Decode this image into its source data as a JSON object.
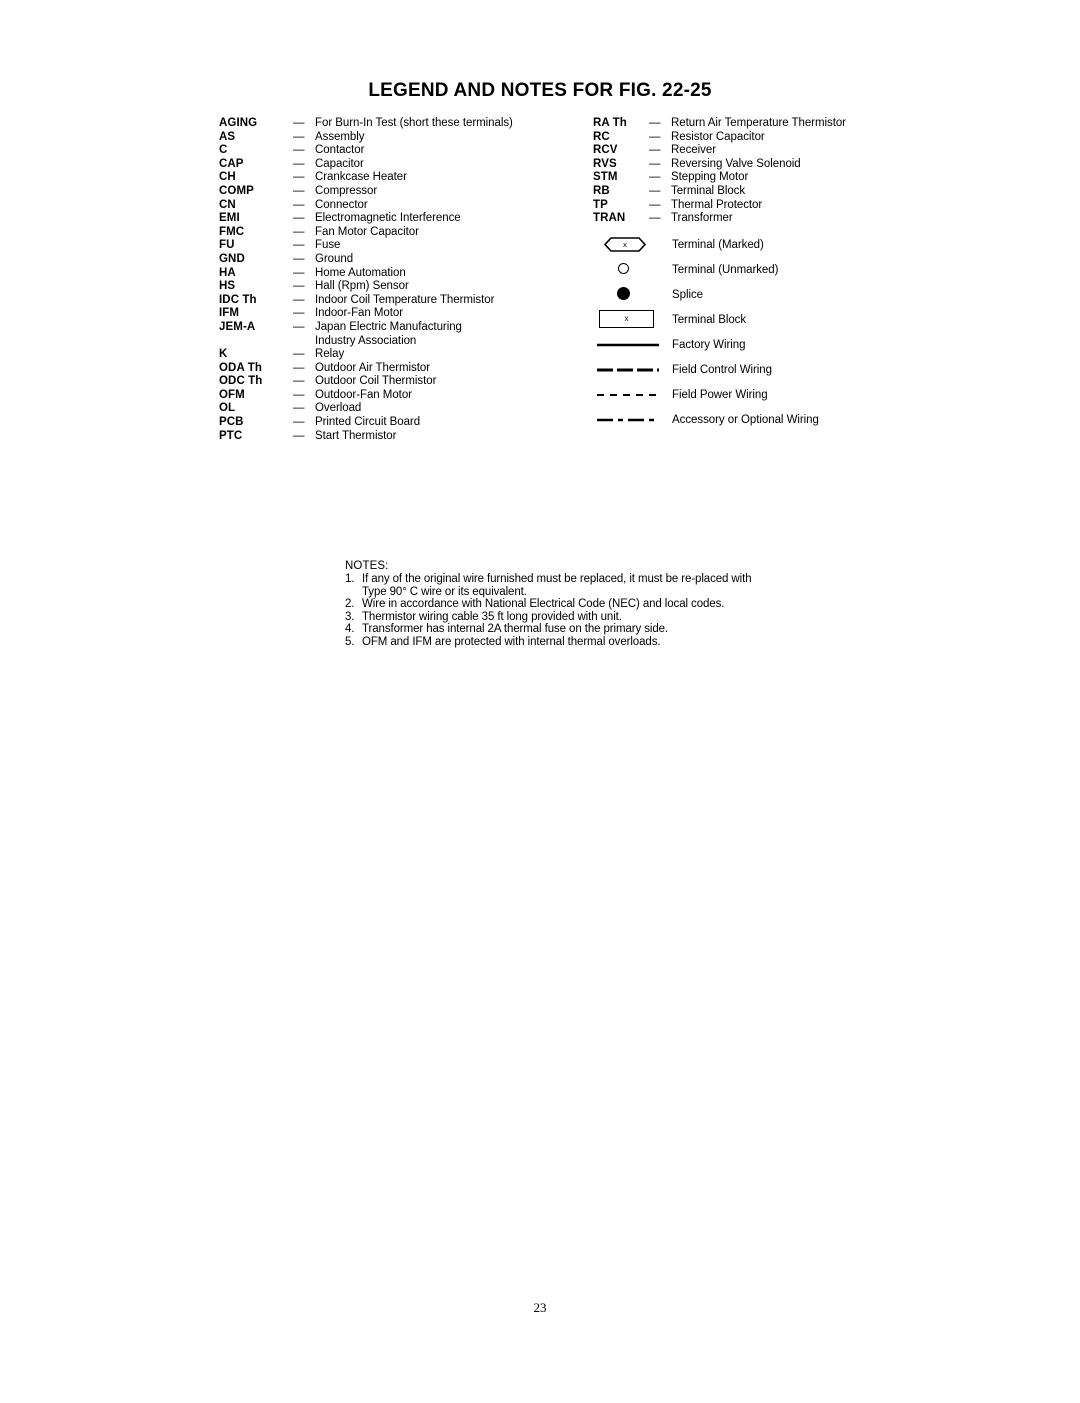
{
  "document": {
    "title": "LEGEND AND NOTES FOR FIG. 22-25",
    "page_number": "23"
  },
  "legend": {
    "separator": "—",
    "left_column": [
      {
        "abbr": "AGING",
        "term": "For Burn-In Test (short these terminals)"
      },
      {
        "abbr": "AS",
        "term": "Assembly"
      },
      {
        "abbr": "C",
        "term": "Contactor"
      },
      {
        "abbr": "CAP",
        "term": "Capacitor"
      },
      {
        "abbr": "CH",
        "term": "Crankcase Heater"
      },
      {
        "abbr": "COMP",
        "term": "Compressor"
      },
      {
        "abbr": "CN",
        "term": "Connector"
      },
      {
        "abbr": "EMI",
        "term": "Electromagnetic Interference"
      },
      {
        "abbr": "FMC",
        "term": "Fan Motor Capacitor"
      },
      {
        "abbr": "FU",
        "term": "Fuse"
      },
      {
        "abbr": "GND",
        "term": "Ground"
      },
      {
        "abbr": "HA",
        "term": "Home Automation"
      },
      {
        "abbr": "HS",
        "term": "Hall (Rpm) Sensor"
      },
      {
        "abbr": "IDC Th",
        "term": "Indoor Coil Temperature Thermistor"
      },
      {
        "abbr": "IFM",
        "term": "Indoor-Fan Motor"
      },
      {
        "abbr": "JEM-A",
        "term": "Japan Electric Manufacturing"
      },
      {
        "abbr": "",
        "term": "Industry Association",
        "continuation": true
      },
      {
        "abbr": "K",
        "term": "Relay"
      },
      {
        "abbr": "ODA Th",
        "term": "Outdoor Air Thermistor"
      },
      {
        "abbr": "ODC Th",
        "term": "Outdoor Coil Thermistor"
      },
      {
        "abbr": "OFM",
        "term": "Outdoor-Fan Motor"
      },
      {
        "abbr": "OL",
        "term": "Overload"
      },
      {
        "abbr": "PCB",
        "term": "Printed Circuit Board"
      },
      {
        "abbr": "PTC",
        "term": "Start Thermistor"
      }
    ],
    "right_column": [
      {
        "abbr": "RA Th",
        "term": "Return Air Temperature Thermistor"
      },
      {
        "abbr": "RC",
        "term": "Resistor Capacitor"
      },
      {
        "abbr": "RCV",
        "term": "Receiver"
      },
      {
        "abbr": "RVS",
        "term": "Reversing Valve Solenoid"
      },
      {
        "abbr": "STM",
        "term": "Stepping Motor"
      },
      {
        "abbr": "RB",
        "term": "Terminal Block"
      },
      {
        "abbr": "TP",
        "term": "Thermal Protector"
      },
      {
        "abbr": "TRAN",
        "term": "Transformer"
      }
    ]
  },
  "symbols": [
    {
      "icon": "hexagon-terminal-icon",
      "marker": "x",
      "label": "Terminal (Marked)"
    },
    {
      "icon": "open-circle-icon",
      "marker": "",
      "label": "Terminal (Unmarked)"
    },
    {
      "icon": "filled-circle-icon",
      "marker": "",
      "label": "Splice"
    },
    {
      "icon": "rectangle-terminal-icon",
      "marker": "x",
      "label": "Terminal Block"
    },
    {
      "icon": "solid-line-icon",
      "marker": "",
      "label": "Factory Wiring"
    },
    {
      "icon": "long-dash-line-icon",
      "marker": "",
      "label": "Field Control Wiring"
    },
    {
      "icon": "short-dash-line-icon",
      "marker": "",
      "label": "Field Power Wiring"
    },
    {
      "icon": "dash-dot-line-icon",
      "marker": "",
      "label": "Accessory or Optional Wiring"
    }
  ],
  "notes": {
    "heading": "NOTES:",
    "items": [
      {
        "num": "1.",
        "text": "If any of the original wire furnished must be replaced, it must be re-placed with Type 90° C wire or its equivalent."
      },
      {
        "num": "2.",
        "text": "Wire in accordance with National Electrical Code (NEC) and local codes."
      },
      {
        "num": "3.",
        "text": "Thermistor wiring cable 35 ft long provided with unit."
      },
      {
        "num": "4.",
        "text": "Transformer has internal 2A thermal fuse on the primary side."
      },
      {
        "num": "5.",
        "text": "OFM and IFM are protected with internal thermal overloads."
      }
    ]
  },
  "colors": {
    "ink": "#000000",
    "paper": "#ffffff"
  }
}
